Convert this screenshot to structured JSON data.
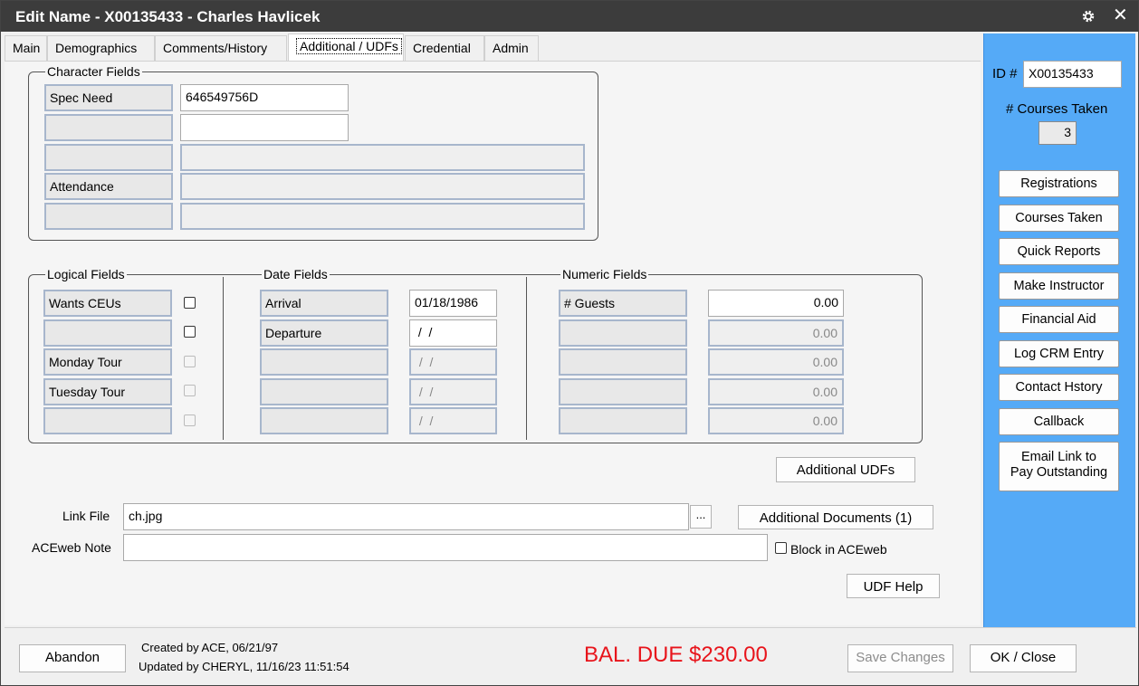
{
  "window": {
    "title": "Edit Name - X00135433 - Charles Havlicek",
    "close_glyph": "✕"
  },
  "tabs": [
    "Main",
    "Demographics",
    "Comments/History",
    "Additional / UDFs",
    "Credential",
    "Admin"
  ],
  "active_tab": "Additional / UDFs",
  "character_fields": {
    "legend": "Character Fields",
    "rows": [
      {
        "label": "Spec Need",
        "value": "646549756D"
      },
      {
        "label": "",
        "value": ""
      },
      {
        "label": "",
        "value": ""
      },
      {
        "label": "Attendance",
        "value": ""
      },
      {
        "label": "",
        "value": ""
      }
    ]
  },
  "logical_fields": {
    "legend": "Logical Fields",
    "rows": [
      {
        "label": "Wants CEUs",
        "checked": false
      },
      {
        "label": "",
        "checked": false
      },
      {
        "label": "Monday Tour",
        "checked": false
      },
      {
        "label": "Tuesday Tour",
        "checked": false
      },
      {
        "label": "",
        "checked": false
      }
    ]
  },
  "date_fields": {
    "legend": "Date Fields",
    "rows": [
      {
        "label": "Arrival",
        "value": "01/18/1986"
      },
      {
        "label": "Departure",
        "value": " /  /"
      },
      {
        "label": "",
        "value": " /  /"
      },
      {
        "label": "",
        "value": " /  /"
      },
      {
        "label": "",
        "value": " /  /"
      }
    ]
  },
  "numeric_fields": {
    "legend": "Numeric Fields",
    "rows": [
      {
        "label": "# Guests",
        "value": "0.00"
      },
      {
        "label": "",
        "value": "0.00"
      },
      {
        "label": "",
        "value": "0.00"
      },
      {
        "label": "",
        "value": "0.00"
      },
      {
        "label": "",
        "value": "0.00"
      }
    ]
  },
  "buttons": {
    "additional_udfs": "Additional UDFs",
    "browse": "...",
    "additional_documents": "Additional Documents (1)",
    "udf_help": "UDF Help",
    "abandon": "Abandon",
    "save_changes": "Save Changes",
    "ok_close": "OK / Close"
  },
  "link_file": {
    "label": "Link File",
    "value": "ch.jpg"
  },
  "aceweb_note": {
    "label": "ACEweb Note",
    "value": ""
  },
  "block_in_aceweb": {
    "label": "Block in ACEweb",
    "checked": false
  },
  "right_panel": {
    "id_label": "ID #",
    "id_value": "X00135433",
    "courses_taken_label": "# Courses Taken",
    "courses_taken_value": "3",
    "buttons": [
      "Registrations",
      "Courses Taken",
      "Quick Reports",
      "Make Instructor",
      "Financial Aid",
      "Log CRM Entry",
      "Contact Hstory",
      "Callback"
    ],
    "email_link": [
      "Email Link to",
      "Pay Outstanding"
    ]
  },
  "footer": {
    "created": "Created by ACE, 06/21/97",
    "updated": "Updated by CHERYL, 11/16/23 11:51:54",
    "balance_due": "BAL. DUE $230.00"
  },
  "colors": {
    "title_bar": "#3c3c3c",
    "right_panel": "#55aaf7",
    "balance_due": "#e8141b"
  }
}
